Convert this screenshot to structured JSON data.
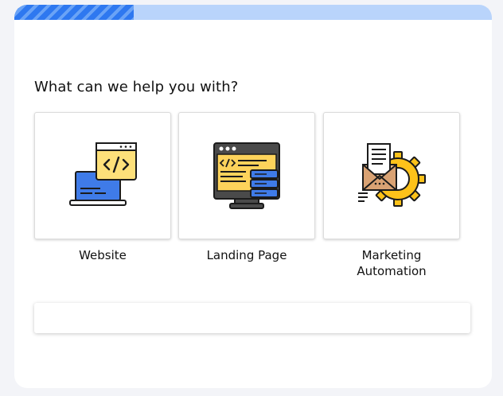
{
  "progress": {
    "value_fraction": 0.25,
    "track_color": "#b9d4fb",
    "fill_color": "#2e78f0"
  },
  "question": "What can we help you with?",
  "options": [
    {
      "label": "Website",
      "icon": "laptop-code-icon"
    },
    {
      "label": "Landing Page",
      "icon": "browser-server-icon"
    },
    {
      "label": "Marketing\nAutomation",
      "icon": "email-gear-icon"
    }
  ],
  "text_field": {
    "value": "",
    "placeholder": ""
  }
}
